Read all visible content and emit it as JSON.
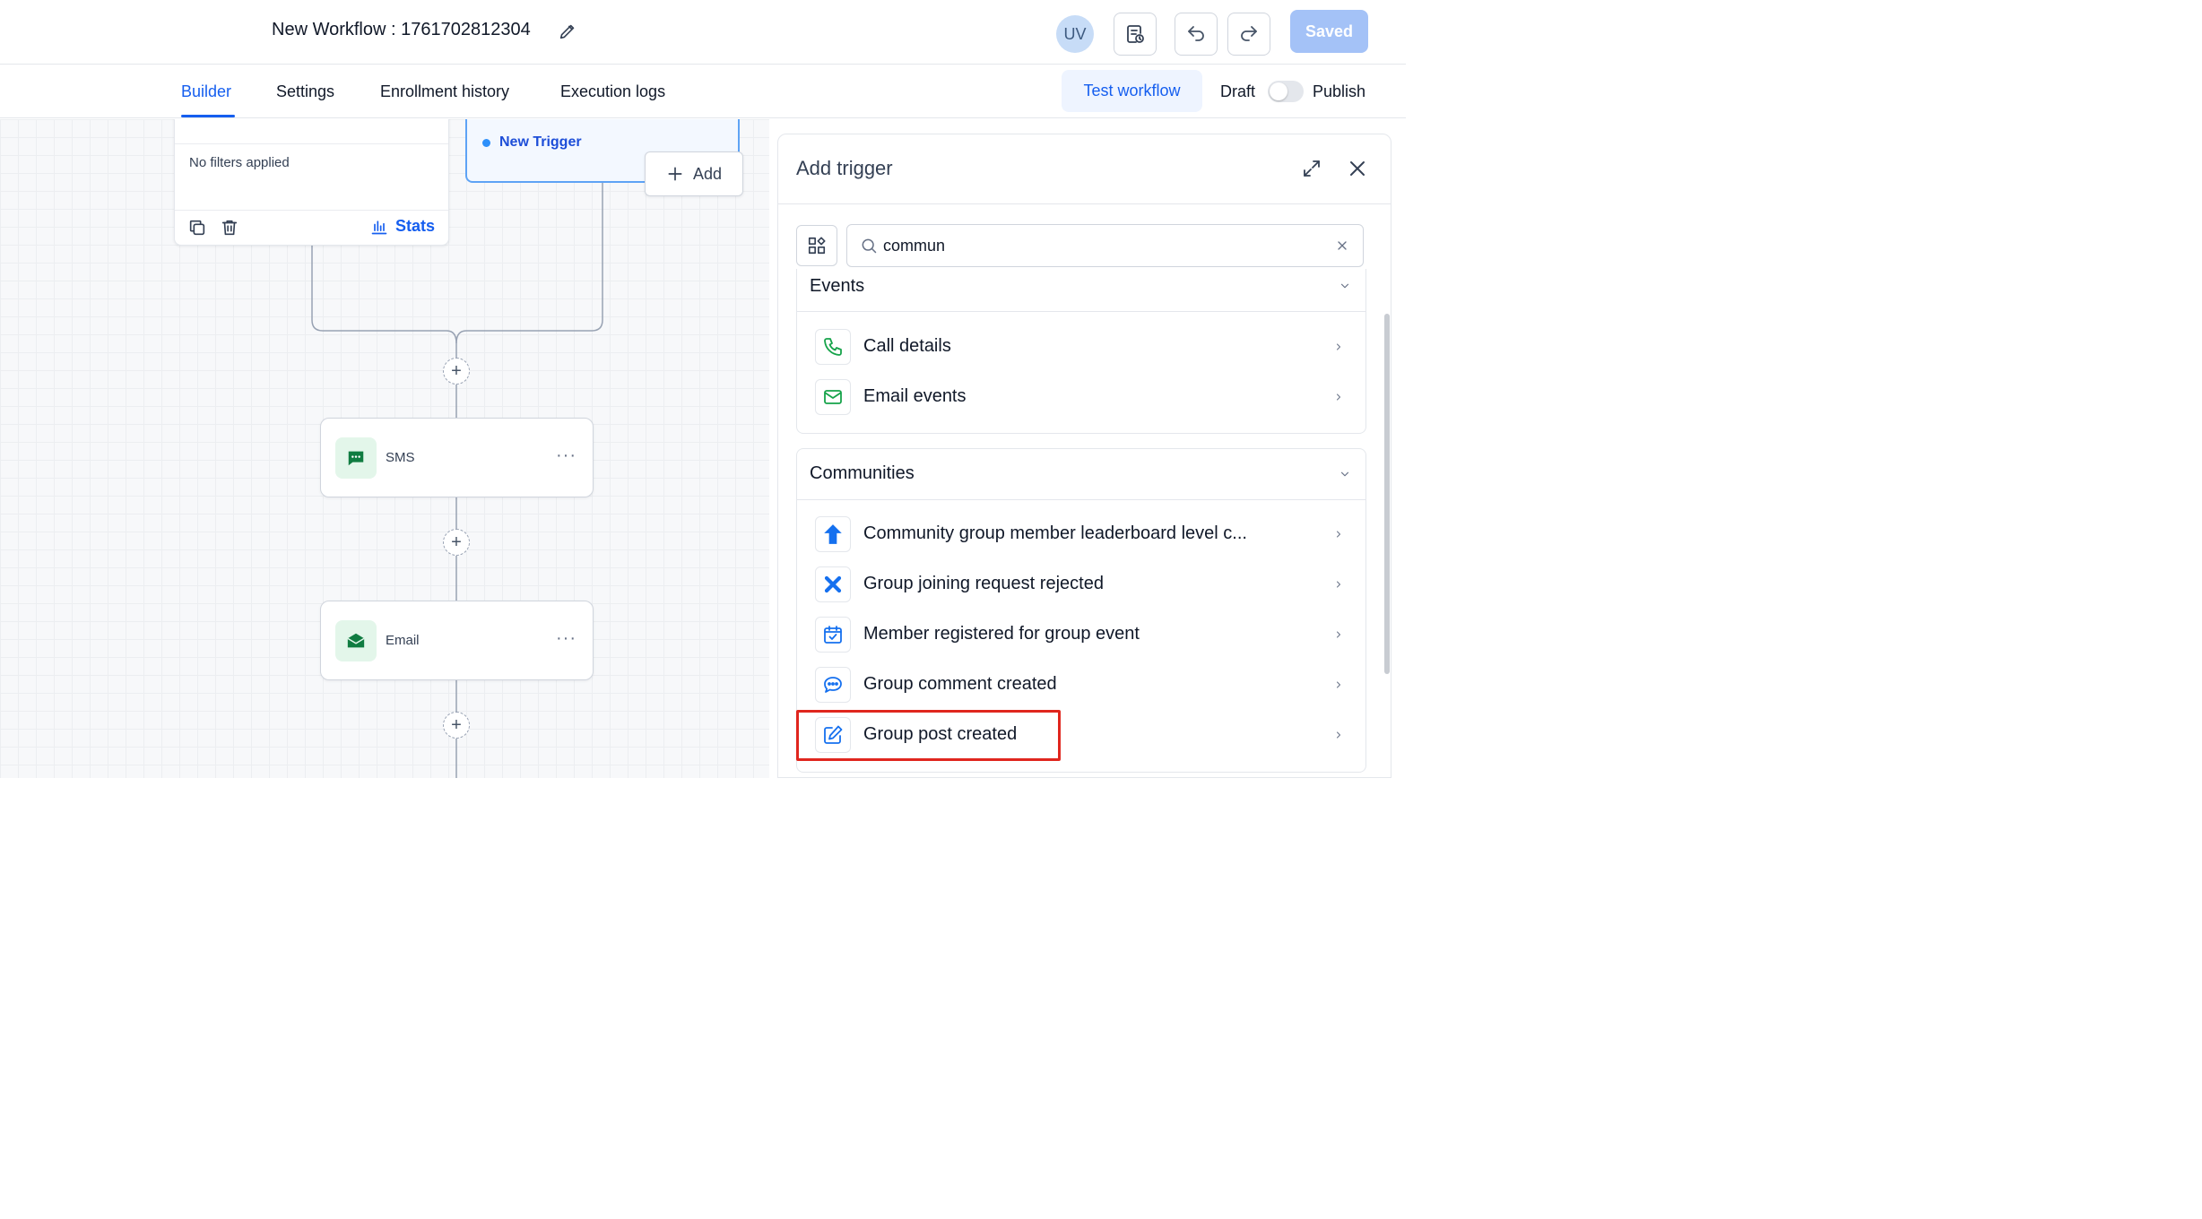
{
  "header": {
    "workflow_title": "New Workflow : 1761702812304",
    "avatar_initials": "UV",
    "saved_label": "Saved"
  },
  "tabs": [
    {
      "label": "Builder",
      "active": true
    },
    {
      "label": "Settings",
      "active": false
    },
    {
      "label": "Enrollment history",
      "active": false
    },
    {
      "label": "Execution logs",
      "active": false
    }
  ],
  "toolbar": {
    "test_label": "Test workflow",
    "draft_label": "Draft",
    "publish_label": "Publish"
  },
  "canvas": {
    "filter_card": {
      "no_filters": "No filters applied",
      "stats_label": "Stats"
    },
    "trigger": {
      "label": "New Trigger"
    },
    "add_label": "Add",
    "actions": [
      {
        "label": "SMS",
        "more": "···"
      },
      {
        "label": "Email",
        "more": "···"
      }
    ],
    "plus_symbol": "+"
  },
  "panel": {
    "title": "Add trigger",
    "search": {
      "value": "commun",
      "placeholder": ""
    },
    "sections": [
      {
        "title": "Events",
        "items": [
          {
            "label": "Call details",
            "icon": "phone-icon"
          },
          {
            "label": "Email events",
            "icon": "mail-icon"
          }
        ]
      },
      {
        "title": "Communities",
        "items": [
          {
            "label": "Community group member leaderboard level c...",
            "icon": "arrow-up-icon"
          },
          {
            "label": "Group joining request rejected",
            "icon": "x-icon"
          },
          {
            "label": "Member registered for group event",
            "icon": "calendar-check-icon"
          },
          {
            "label": "Group comment created",
            "icon": "chat-bubble-icon"
          },
          {
            "label": "Group post created",
            "icon": "edit-note-icon",
            "highlighted": true
          }
        ]
      }
    ]
  },
  "colors": {
    "accent": "#155eef",
    "saved_button": "#a4c2f7",
    "highlight_box": "#e0261e",
    "trigger_border": "#5ea3f5"
  }
}
